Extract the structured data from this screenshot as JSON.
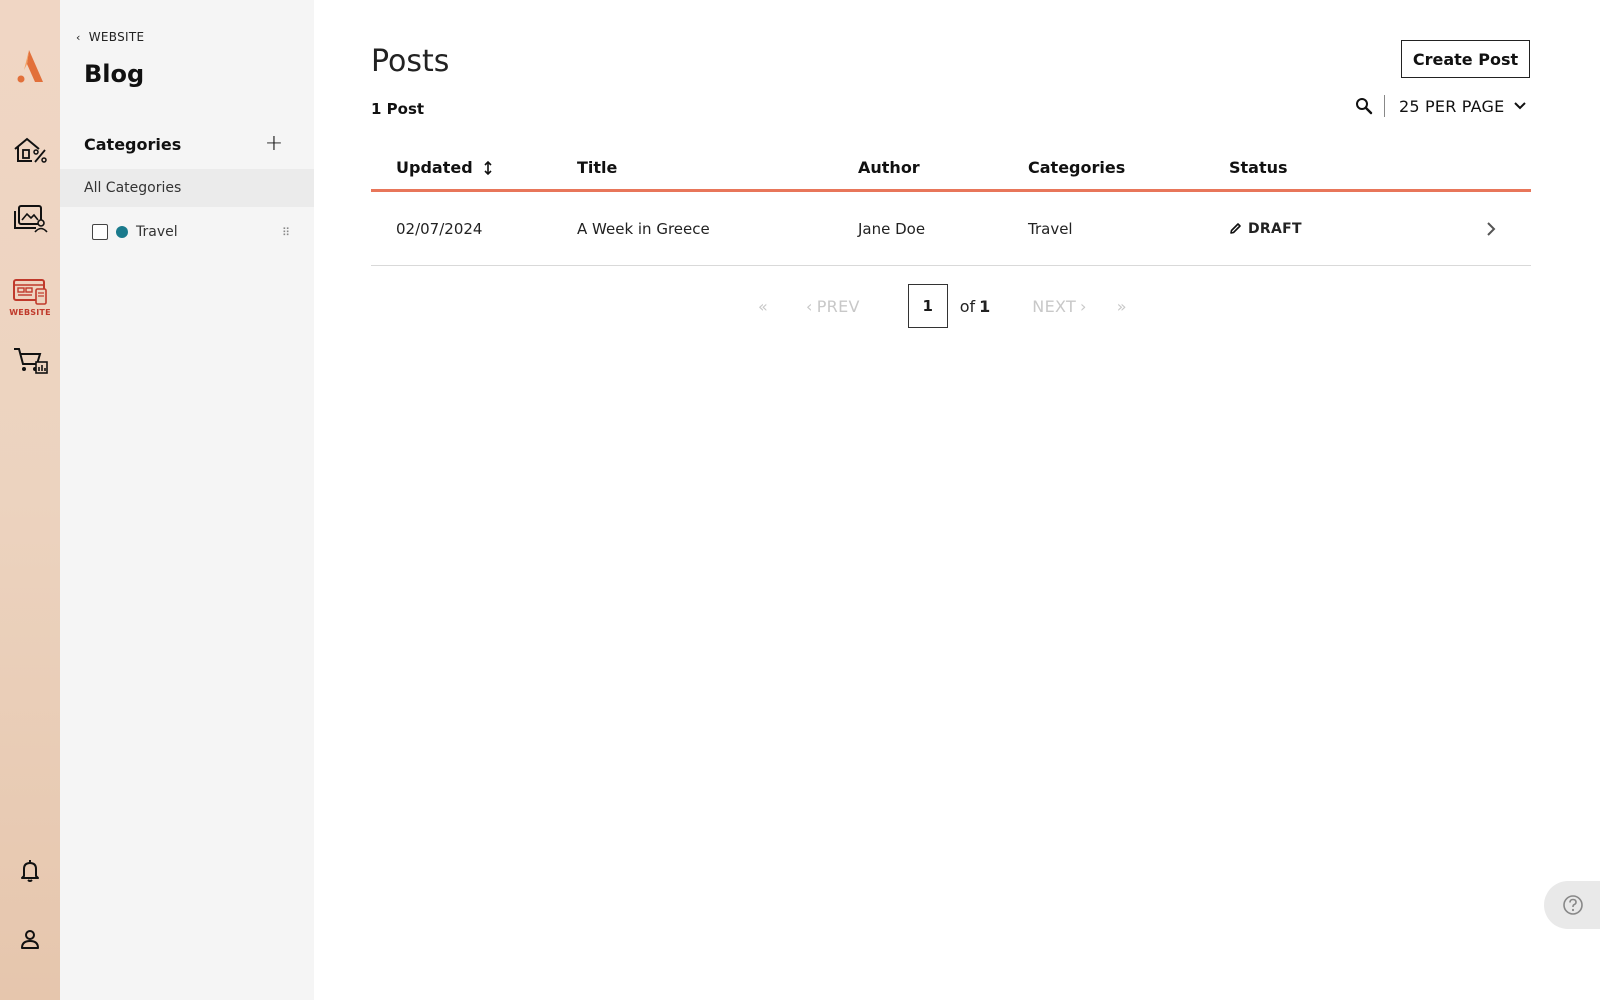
{
  "rail": {
    "logo_icon": "brand-logo-icon",
    "items": [
      {
        "icon": "home-percent-icon",
        "label": ""
      },
      {
        "icon": "gallery-user-icon",
        "label": ""
      },
      {
        "icon": "website-icon",
        "label": "WEBSITE",
        "active": true
      },
      {
        "icon": "cart-chart-icon",
        "label": ""
      }
    ],
    "bottom": [
      {
        "icon": "bell-icon"
      },
      {
        "icon": "user-icon"
      }
    ],
    "accent": "#c0392b"
  },
  "sidebar": {
    "back_label": "WEBSITE",
    "title": "Blog",
    "categories_label": "Categories",
    "add_label": "+",
    "all_categories": "All Categories",
    "items": [
      {
        "name": "Travel",
        "color": "#1a7a8c"
      }
    ]
  },
  "main": {
    "title": "Posts",
    "create_button": "Create Post",
    "post_count": "1 Post",
    "per_page": "25 PER PAGE",
    "table": {
      "columns": [
        "Updated",
        "Title",
        "Author",
        "Categories",
        "Status"
      ],
      "rows": [
        {
          "updated": "02/07/2024",
          "title": "A Week in Greece",
          "author": "Jane Doe",
          "categories": "Travel",
          "status": "DRAFT"
        }
      ]
    },
    "pagination": {
      "first": "«",
      "prev": "PREV",
      "current": "1",
      "of": "of",
      "total": "1",
      "next": "NEXT",
      "last": "»"
    }
  },
  "colors": {
    "header_underline": "#e8765a",
    "logo": "#e2703a"
  }
}
